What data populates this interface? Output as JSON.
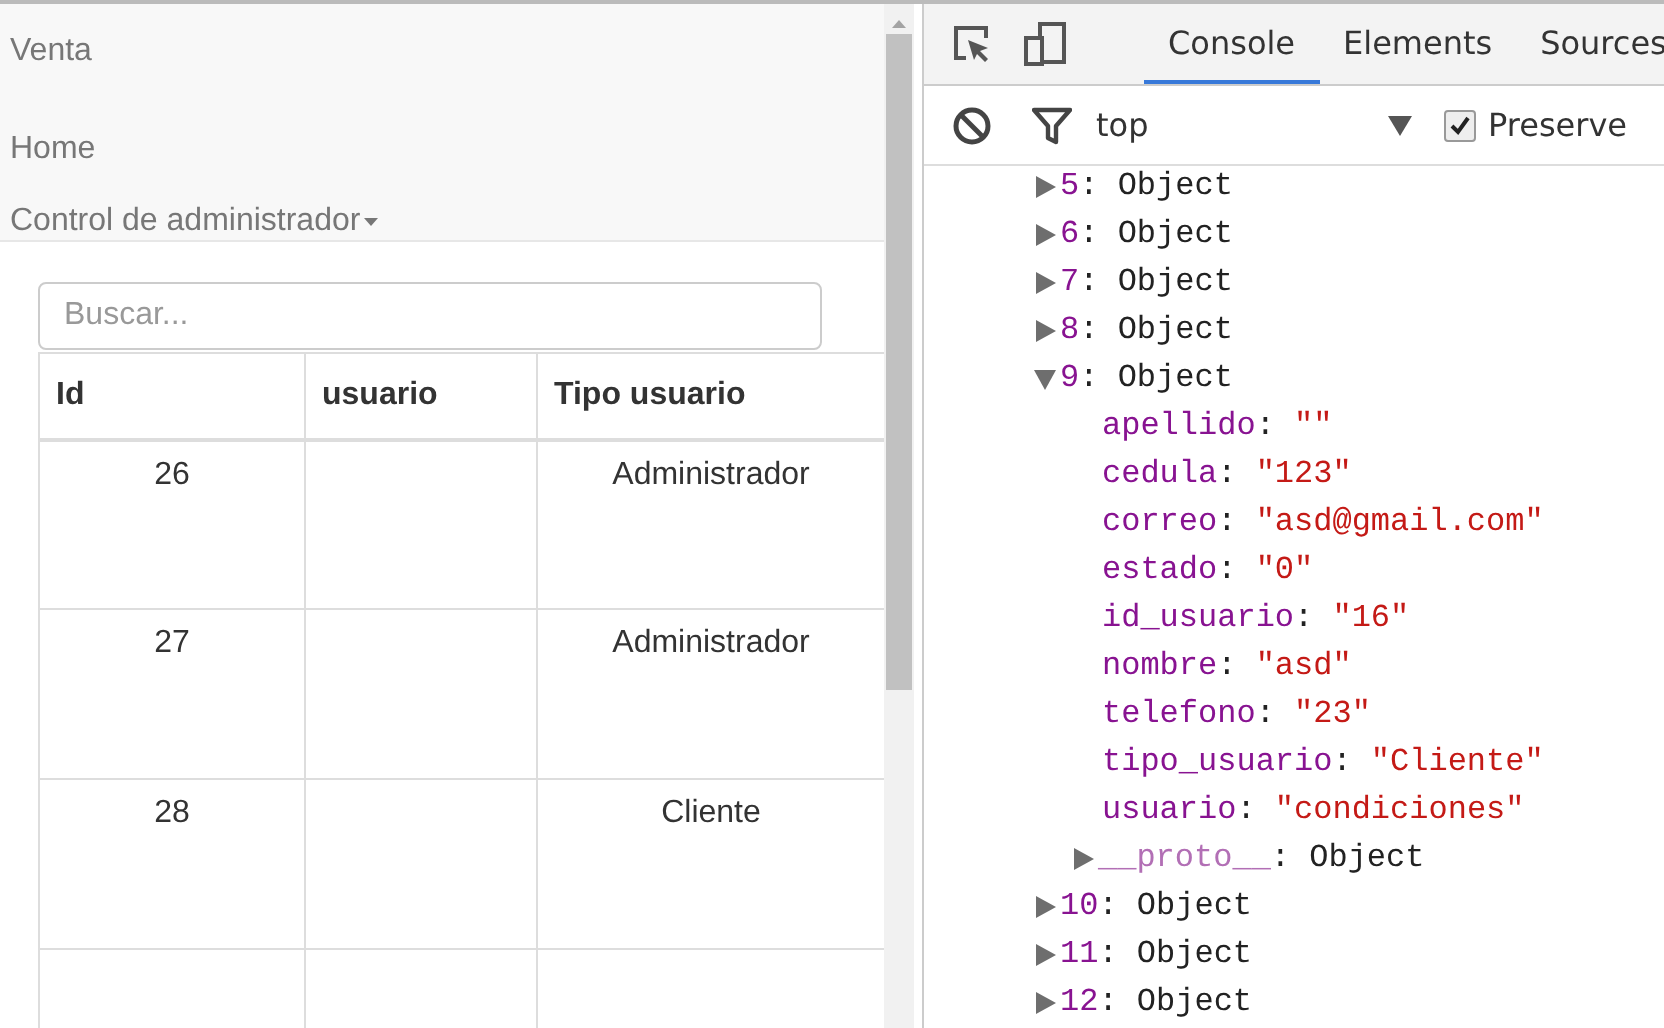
{
  "page": {
    "brand": "Venta",
    "nav": [
      {
        "label": "Home",
        "kind": "link"
      },
      {
        "label": "Control de administrador",
        "kind": "dropdown"
      }
    ],
    "search": {
      "placeholder": "Buscar..."
    },
    "table": {
      "columns": [
        "Id",
        "usuario",
        "Tipo usuario"
      ],
      "rows": [
        {
          "id": "26",
          "tipo_usuario": "Administrador"
        },
        {
          "id": "27",
          "tipo_usuario": "Administrador"
        },
        {
          "id": "28",
          "tipo_usuario": "Cliente"
        }
      ]
    }
  },
  "devtools": {
    "tabs": [
      {
        "label": "Console",
        "selected": true
      },
      {
        "label": "Elements",
        "selected": false
      },
      {
        "label": "Sources",
        "selected": false
      }
    ],
    "context": "top",
    "preserve_log": {
      "label": "Preserve",
      "checked": true
    },
    "console": [
      {
        "index": "5:",
        "value": "Object",
        "expanded": false
      },
      {
        "index": "6:",
        "value": "Object",
        "expanded": false
      },
      {
        "index": "7:",
        "value": "Object",
        "expanded": false
      },
      {
        "index": "8:",
        "value": "Object",
        "expanded": false
      },
      {
        "index": "9:",
        "value": "Object",
        "expanded": true,
        "children": [
          {
            "key": "apellido:",
            "value": "\"\"",
            "kind": "string"
          },
          {
            "key": "cedula:",
            "value": "\"123\"",
            "kind": "string"
          },
          {
            "key": "correo:",
            "value": "\"asd@gmail.com\"",
            "kind": "string"
          },
          {
            "key": "estado:",
            "value": "\"0\"",
            "kind": "string"
          },
          {
            "key": "id_usuario:",
            "value": "\"16\"",
            "kind": "string"
          },
          {
            "key": "nombre:",
            "value": "\"asd\"",
            "kind": "string"
          },
          {
            "key": "telefono:",
            "value": "\"23\"",
            "kind": "string"
          },
          {
            "key": "tipo_usuario:",
            "value": "\"Cliente\"",
            "kind": "string"
          },
          {
            "key": "usuario:",
            "value": "\"condiciones\"",
            "kind": "string"
          },
          {
            "key": "__proto__:",
            "value": "Object",
            "kind": "proto",
            "expanded": false
          }
        ]
      },
      {
        "index": "10:",
        "value": "Object",
        "expanded": false
      },
      {
        "index": "11:",
        "value": "Object",
        "expanded": false
      },
      {
        "index": "12:",
        "value": "Object",
        "expanded": false
      }
    ]
  }
}
